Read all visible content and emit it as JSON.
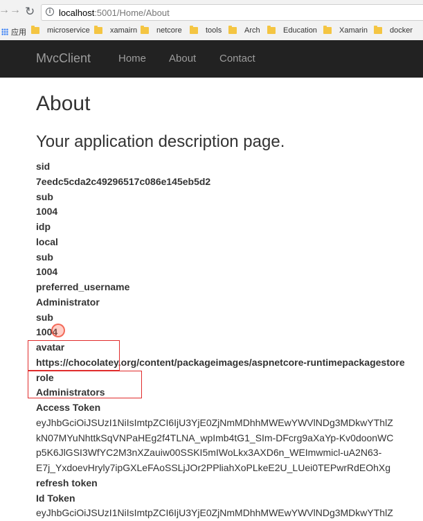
{
  "browser": {
    "url_host": "localhost",
    "url_path": ":5001/Home/About",
    "bookmarks": [
      {
        "label": "应用",
        "icon": "apps-grid-icon"
      },
      {
        "label": "microservice",
        "icon": "folder-icon"
      },
      {
        "label": "xamairn",
        "icon": "folder-icon"
      },
      {
        "label": "netcore",
        "icon": "folder-icon"
      },
      {
        "label": "tools",
        "icon": "folder-icon"
      },
      {
        "label": "Arch",
        "icon": "folder-icon"
      },
      {
        "label": "Education",
        "icon": "folder-icon"
      },
      {
        "label": "Xamarin",
        "icon": "folder-icon"
      },
      {
        "label": "docker",
        "icon": "folder-icon"
      }
    ]
  },
  "navbar": {
    "brand": "MvcClient",
    "links": [
      "Home",
      "About",
      "Contact"
    ]
  },
  "page": {
    "title": "About",
    "subtitle": "Your application description page."
  },
  "claims": [
    {
      "text": "sid",
      "bold": true
    },
    {
      "text": "7eedc5cda2c49296517c086e145eb5d2",
      "bold": true
    },
    {
      "text": "sub",
      "bold": true
    },
    {
      "text": "1004",
      "bold": true
    },
    {
      "text": "idp",
      "bold": true
    },
    {
      "text": "local",
      "bold": true
    },
    {
      "text": "sub",
      "bold": true
    },
    {
      "text": "1004",
      "bold": true
    },
    {
      "text": "preferred_username",
      "bold": true
    },
    {
      "text": "Administrator",
      "bold": true
    },
    {
      "text": "sub",
      "bold": true
    },
    {
      "text": "1004",
      "bold": true
    },
    {
      "text": "avatar",
      "bold": true
    },
    {
      "text": "https://chocolatey.org/content/packageimages/aspnetcore-runtimepackagestore",
      "bold": true
    },
    {
      "text": "role",
      "bold": true
    },
    {
      "text": "Administrators",
      "bold": true
    },
    {
      "text": "Access Token",
      "bold": true
    },
    {
      "text": "eyJhbGciOiJSUzI1NiIsImtpZCI6IjU3YjE0ZjNmMDhhMWEwYWVlNDg3MDkwYThlZ",
      "bold": false
    },
    {
      "text": "kN07MYuNhttkSqVNPaHEg2f4TLNA_wpImb4tG1_SIm-DFcrg9aXaYp-Kv0doonWC",
      "bold": false
    },
    {
      "text": "p5K6JlGSI3WfYC2M3nXZauiw00SSKI5mIWoLkx3AXD6n_WEImwmicl-uA2N63-",
      "bold": false
    },
    {
      "text": "E7j_YxdoevHryly7ipGXLeFAoSSLjJOr2PPliahXoPLkeE2U_LUei0TEPwrRdEOhXg",
      "bold": false
    },
    {
      "text": "refresh token",
      "bold": true
    },
    {
      "text": "Id Token",
      "bold": true
    },
    {
      "text": "eyJhbGciOiJSUzI1NiIsImtpZCI6IjU3YjE0ZjNmMDhhMWEwYWVlNDg3MDkwYThlZ",
      "bold": false
    }
  ]
}
